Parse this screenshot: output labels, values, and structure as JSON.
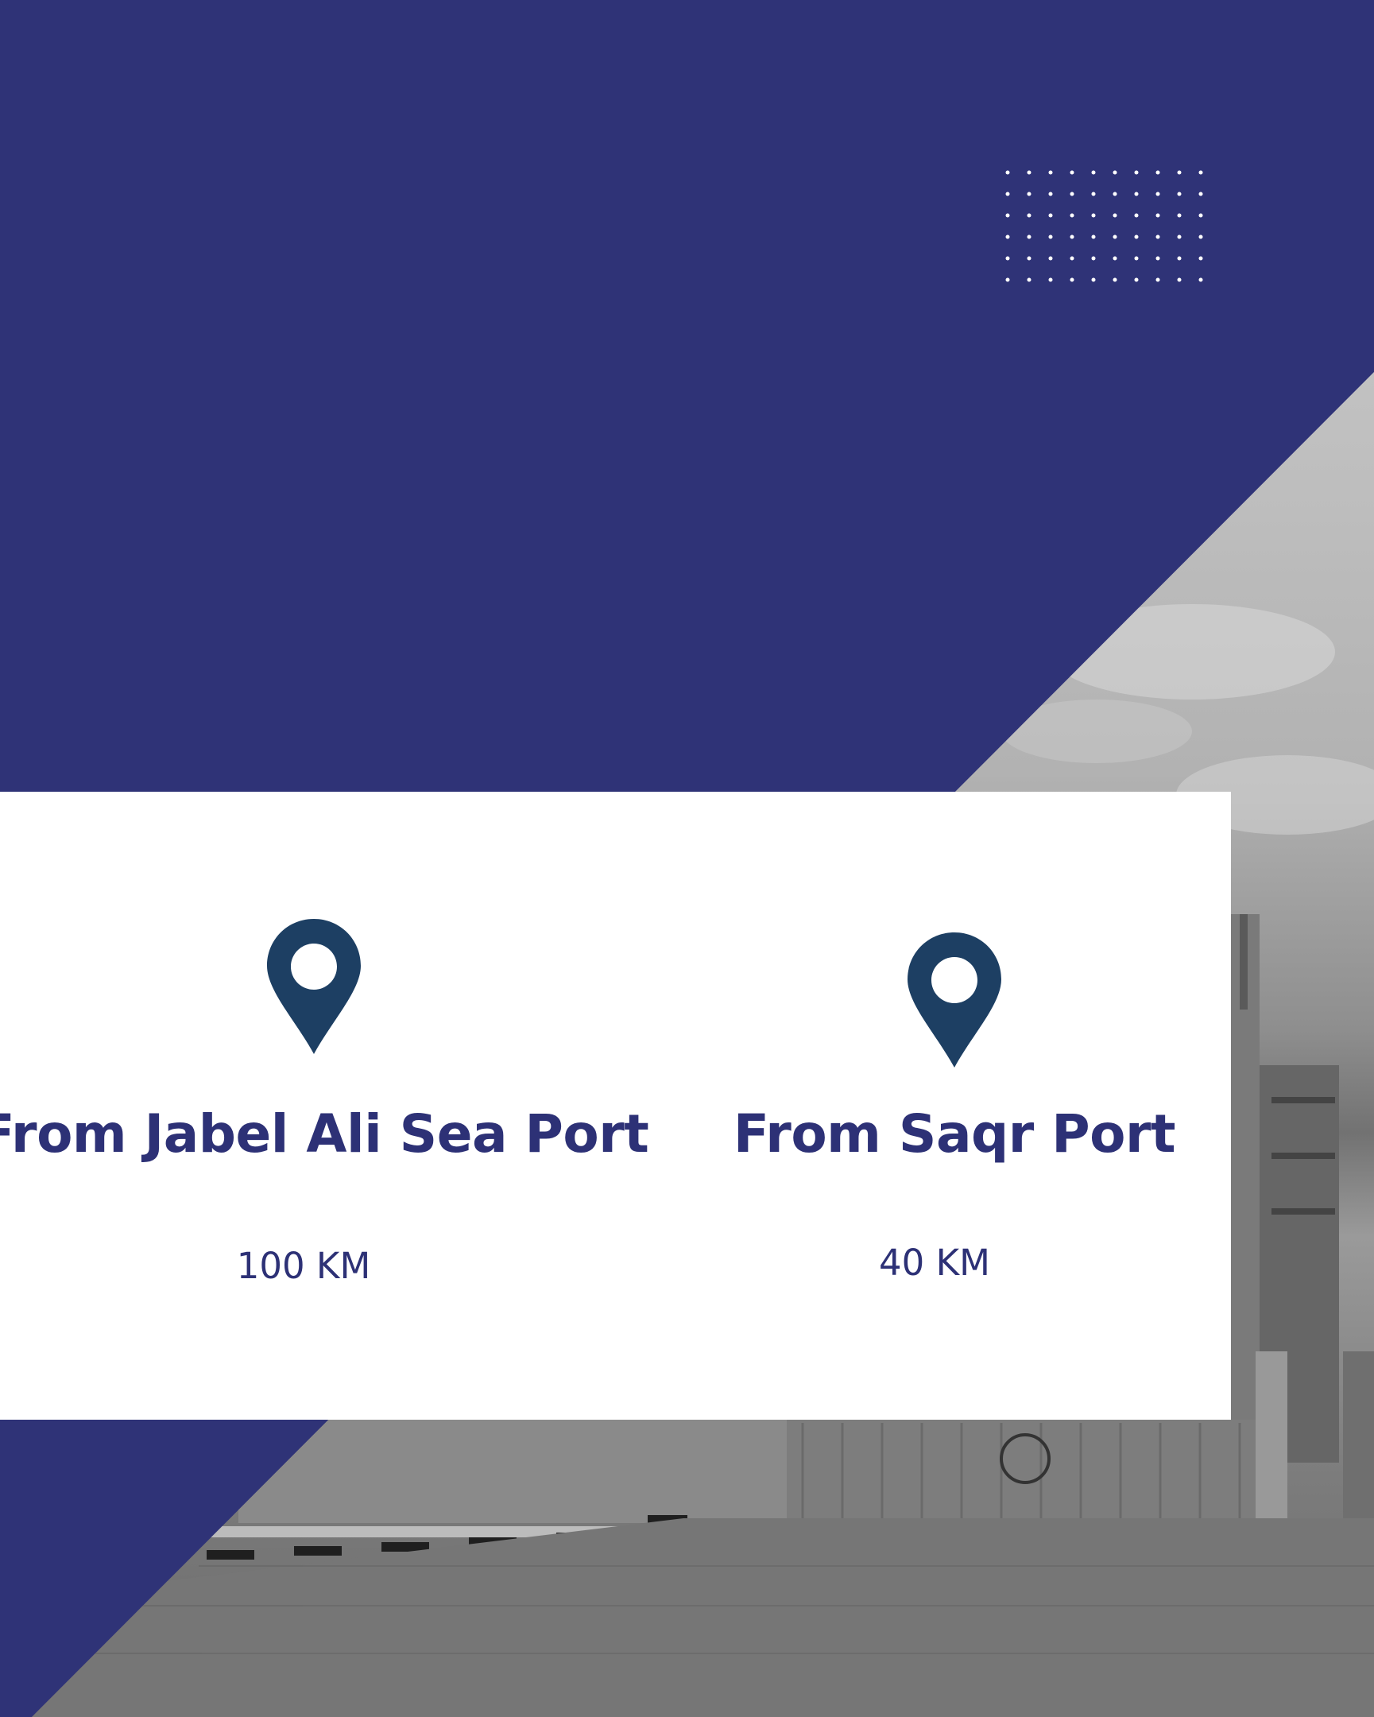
{
  "colors": {
    "background": "#2f3377",
    "card": "#ffffff",
    "text": "#2d3176",
    "pin": "#1d3f63"
  },
  "locations": [
    {
      "icon": "location-pin-icon",
      "title": "From Jabel Ali Sea Port",
      "distance": "100 KM"
    },
    {
      "icon": "location-pin-icon",
      "title": "From Saqr Port",
      "distance": "40 KM"
    }
  ]
}
